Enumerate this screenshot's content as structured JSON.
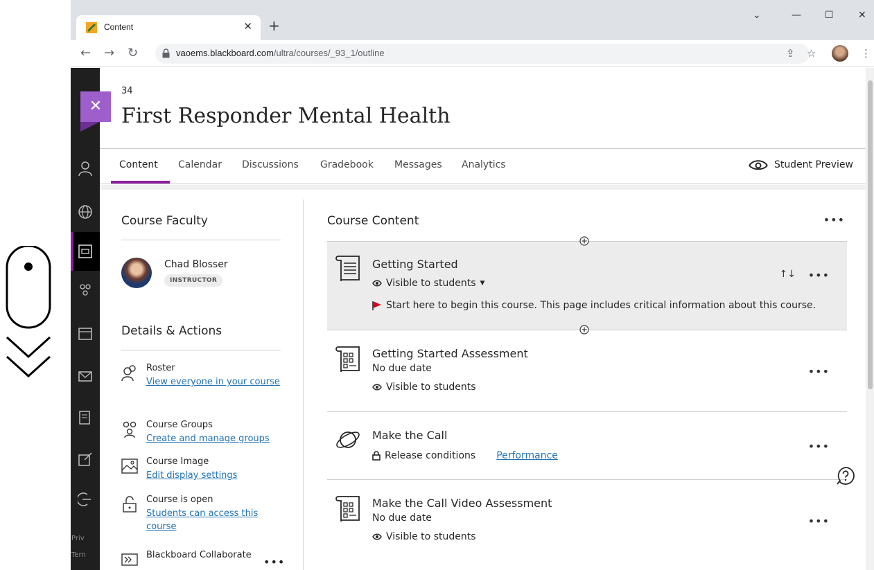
{
  "browser": {
    "tab_title": "Content",
    "url_host": "vaoems.blackboard.com",
    "url_path": "/ultra/courses/_93_1/outline"
  },
  "course": {
    "number": "34",
    "title": "First Responder Mental Health"
  },
  "tabs": [
    {
      "label": "Content"
    },
    {
      "label": "Calendar"
    },
    {
      "label": "Discussions"
    },
    {
      "label": "Gradebook"
    },
    {
      "label": "Messages"
    },
    {
      "label": "Analytics"
    }
  ],
  "student_preview": "Student Preview",
  "faculty": {
    "heading": "Course Faculty",
    "name": "Chad Blosser",
    "role": "INSTRUCTOR"
  },
  "details": {
    "heading": "Details & Actions",
    "items": [
      {
        "title": "Roster",
        "link": "View everyone in your course",
        "icon": "roster-icon"
      },
      {
        "title": "Course Groups",
        "link": "Create and manage groups",
        "icon": "groups-icon"
      },
      {
        "title": "Course Image",
        "link": "Edit display settings",
        "icon": "image-icon"
      },
      {
        "title": "Course is open",
        "link": "Students can access this course",
        "icon": "unlock-icon"
      },
      {
        "title": "Blackboard Collaborate",
        "link": "",
        "icon": "collaborate-icon"
      }
    ]
  },
  "content": {
    "heading": "Course Content",
    "items": [
      {
        "title": "Getting Started",
        "visibility": "Visible to students",
        "description": "Start here to begin this course. This page includes critical information about this course."
      },
      {
        "title": "Getting Started Assessment",
        "due": "No due date",
        "visibility": "Visible to students"
      },
      {
        "title": "Make the Call",
        "release": "Release conditions",
        "performance": "Performance"
      },
      {
        "title": "Make the Call Video Assessment",
        "due": "No due date",
        "visibility": "Visible to students"
      }
    ]
  },
  "leftnav_text": [
    "Priv",
    "Tern"
  ],
  "colors": {
    "accent": "#8c1d9e",
    "link": "#2172b5",
    "flag": "#d0021b"
  }
}
